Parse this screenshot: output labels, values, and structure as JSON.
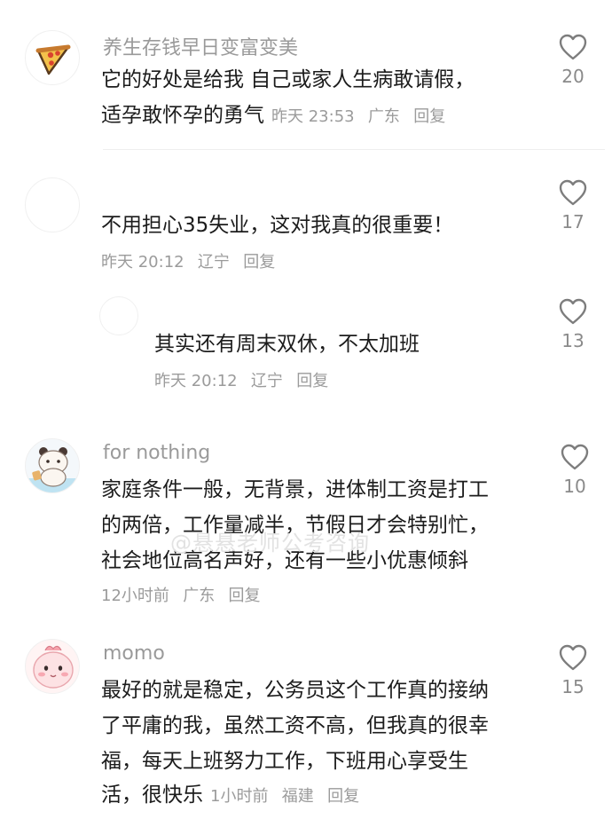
{
  "comments": [
    {
      "user": "养生存钱早日变富变美",
      "lines": [
        "它的好处是给我 自己或家人生病敢请假，",
        "适孕敢怀孕的勇气"
      ],
      "time": "昨天 23:53",
      "location": "广东",
      "reply": "回复",
      "likes": "20",
      "avatar_icon": "pizza-avatar-icon"
    },
    {
      "user": "",
      "lines": [
        "不用担心35失业，这对我真的很重要！"
      ],
      "time": "昨天 20:12",
      "location": "辽宁",
      "reply": "回复",
      "likes": "17",
      "avatar_icon": "blank-avatar-icon"
    },
    {
      "user": "",
      "lines": [
        "其实还有周末双休，不太加班"
      ],
      "time": "昨天 20:12",
      "location": "辽宁",
      "reply": "回复",
      "likes": "13",
      "avatar_icon": "blank-avatar-icon"
    },
    {
      "user": "for nothing",
      "lines": [
        "家庭条件一般，无背景，进体制工资是打工",
        "的两倍，工作量减半，节假日才会特别忙，",
        "社会地位高名声好，还有一些小优惠倾斜"
      ],
      "time": "12小时前",
      "location": "广东",
      "reply": "回复",
      "likes": "10",
      "avatar_icon": "panda-avatar-icon"
    },
    {
      "user": "momo",
      "lines": [
        "最好的就是稳定，公务员这个工作真的接纳",
        "了平庸的我，虽然工资不高，但我真的很幸",
        "福，每天上班努力工作，下班用心享受生",
        "活，很快乐"
      ],
      "time": "1小时前",
      "location": "福建",
      "reply": "回复",
      "likes": "15",
      "avatar_icon": "pink-blob-avatar-icon"
    }
  ],
  "watermark": "@悬悬老师公考咨询",
  "colors": {
    "text": "#1c1c1c",
    "meta": "#9b9b9b",
    "heart": "#7d7d7d"
  }
}
